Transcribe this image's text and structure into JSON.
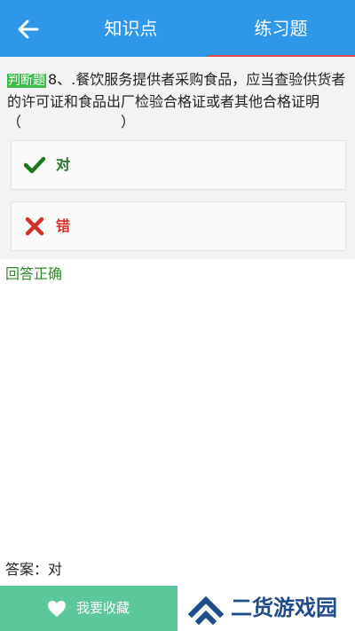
{
  "header": {
    "back_icon": "arrow-left-icon",
    "tabs": [
      {
        "label": "知识点",
        "active": false
      },
      {
        "label": "练习题",
        "active": true
      }
    ],
    "bar_color": "#2f97e8",
    "active_underline_color": "#e24a4a"
  },
  "question": {
    "type_badge": "判断题",
    "text": "8、.餐饮服务提供者采购食品，应当查验供货者的许可证和食品出厂检验合格证或者其他合格证明（　　　　　　　）"
  },
  "options": [
    {
      "label": "对",
      "icon": "check-icon",
      "color": "#1f7a1f"
    },
    {
      "label": "错",
      "icon": "cross-icon",
      "color": "#d3322a"
    }
  ],
  "result_text": "回答正确",
  "answer_text": "答案：对",
  "footer": {
    "favorite_label": "我要收藏",
    "favorite_icon": "heart-icon",
    "brand_text": "二货游戏园",
    "brand_logo": "chevron-up-logo"
  }
}
